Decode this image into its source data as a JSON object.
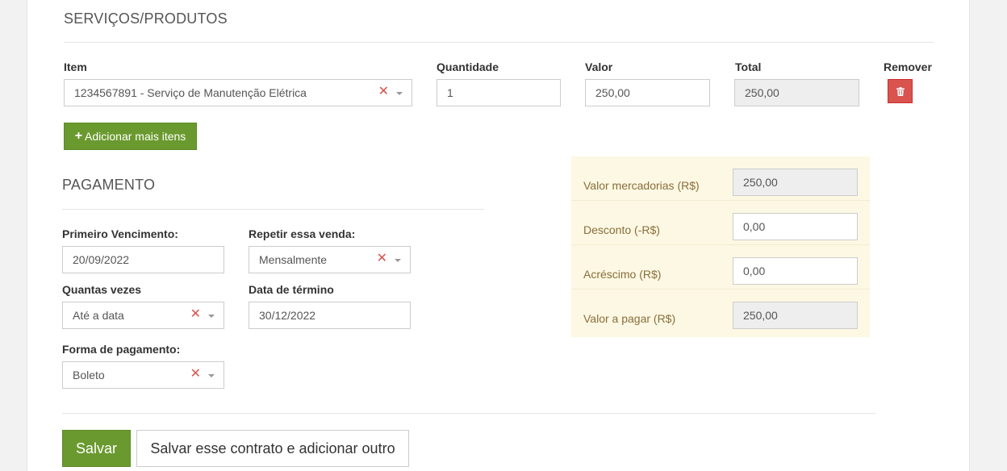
{
  "services": {
    "title": "SERVIÇOS/PRODUTOS",
    "col_item": "Item",
    "col_qty": "Quantidade",
    "col_value": "Valor",
    "col_total": "Total",
    "col_remove": "Remover",
    "row": {
      "item": "1234567891 - Serviço de Manutenção Elétrica",
      "quantity": "1",
      "value": "250,00",
      "total": "250,00"
    },
    "add_button": "Adicionar mais itens"
  },
  "payment": {
    "title": "PAGAMENTO",
    "first_due_label": "Primeiro Vencimento:",
    "first_due_value": "20/09/2022",
    "repeat_label": "Repetir essa venda:",
    "repeat_value": "Mensalmente",
    "times_label": "Quantas vezes",
    "times_value": "Até a data",
    "end_date_label": "Data de término",
    "end_date_value": "30/12/2022",
    "method_label": "Forma de pagamento:",
    "method_value": "Boleto"
  },
  "summary": {
    "goods_label": "Valor mercadorias (R$)",
    "goods_value": "250,00",
    "discount_label": "Desconto (-R$)",
    "discount_value": "0,00",
    "addition_label": "Acréscimo (R$)",
    "addition_value": "0,00",
    "total_label": "Valor a pagar (R$)",
    "total_value": "250,00"
  },
  "actions": {
    "save": "Salvar",
    "save_and_add": "Salvar esse contrato e adicionar outro"
  },
  "colors": {
    "green": "#6a9a2f",
    "danger": "#d9534f",
    "summary_bg": "#fcf8e3",
    "summary_text": "#8a6d3b"
  }
}
